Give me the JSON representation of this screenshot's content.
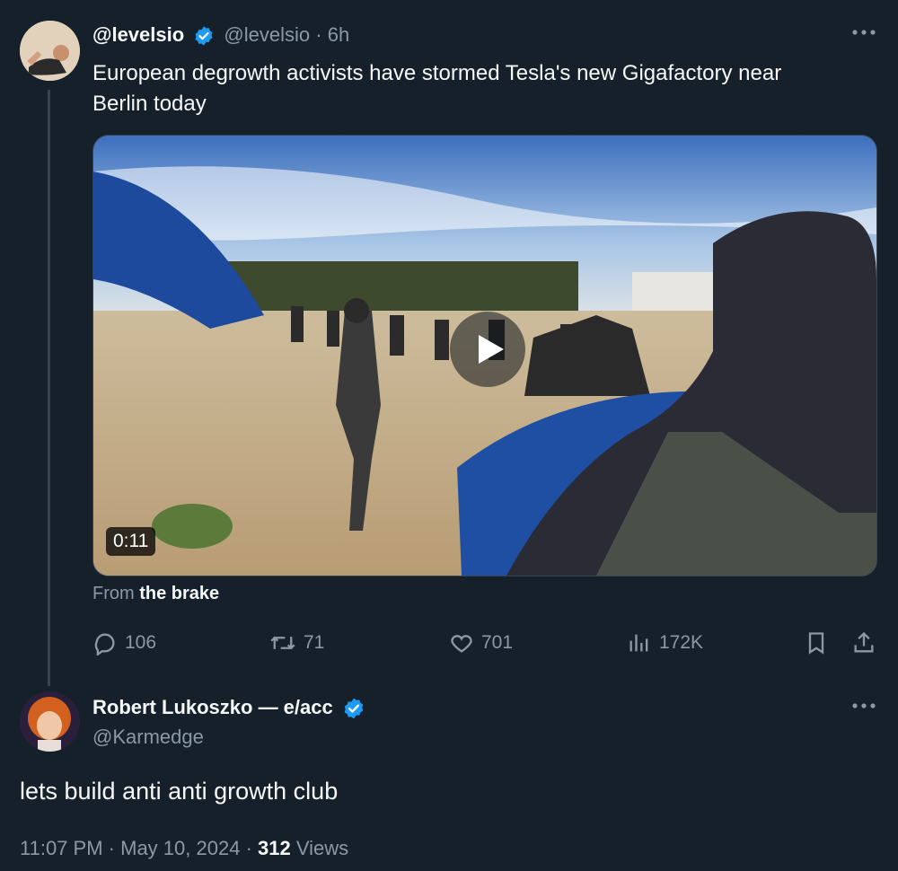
{
  "tweet": {
    "display_name": "@levelsio",
    "handle": "@levelsio",
    "separator": "·",
    "time_ago": "6h",
    "text_line1": "European degrowth activists have stormed Tesla's new Gigafactory near",
    "text_line2": "Berlin today",
    "media": {
      "duration": "0:11",
      "from_prefix": "From",
      "from_source": "the brake"
    },
    "actions": {
      "replies": "106",
      "retweets": "71",
      "likes": "701",
      "views": "172K"
    }
  },
  "reply": {
    "display_name": "Robert Lukoszko — e/acc",
    "handle": "@Karmedge",
    "text": "lets build anti anti growth club",
    "time": "11:07 PM",
    "sep1": "·",
    "date": "May 10, 2024",
    "sep2": "·",
    "views_count": "312",
    "views_label": "Views"
  },
  "icons": {
    "more": "more-icon",
    "verified": "verified-badge-icon",
    "reply": "reply-icon",
    "retweet": "retweet-icon",
    "like": "heart-icon",
    "views": "analytics-icon",
    "bookmark": "bookmark-icon",
    "share": "share-icon",
    "play": "play-icon"
  },
  "colors": {
    "background": "#15202b",
    "text": "#f7f9f9",
    "muted": "#8b98a5",
    "verified": "#1d9bf0"
  }
}
